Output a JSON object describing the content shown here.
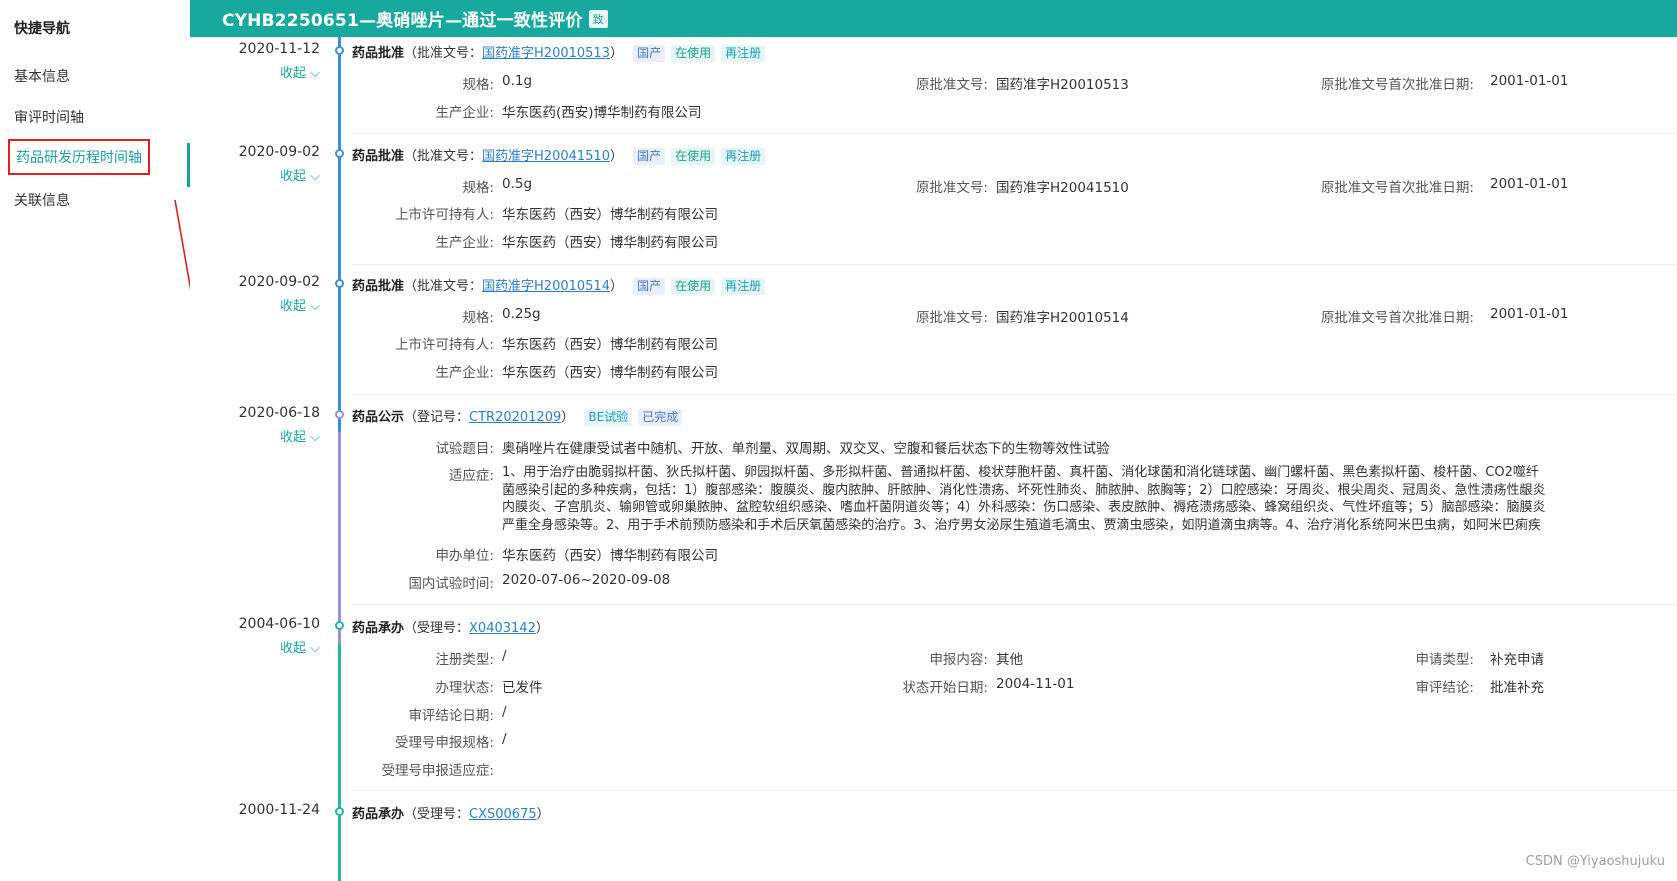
{
  "sidebar": {
    "title": "快捷导航",
    "items": [
      {
        "label": "基本信息"
      },
      {
        "label": "审评时间轴"
      },
      {
        "label": "药品研发历程时间轴"
      },
      {
        "label": "关联信息"
      }
    ]
  },
  "header": {
    "title": "CYHB2250651—奥硝唑片—通过一致性评价",
    "badge": "致"
  },
  "collapse_label": "收起",
  "entries": [
    {
      "date": "2020-11-12",
      "type": "药品批准",
      "ref_prefix": "（批准文号：",
      "ref": "国药准字H20010513",
      "ref_suffix": "）",
      "tags": [
        "国产",
        "在使用",
        "再注册"
      ],
      "spec_label": "规格:",
      "spec": "0.1g",
      "orig_label": "原批准文号:",
      "orig": "国药准字H20010513",
      "first_label": "原批准文号首次批准日期:",
      "first": "2001-01-01",
      "mfr_label": "生产企业:",
      "mfr": "华东医药(西安)博华制药有限公司"
    },
    {
      "date": "2020-09-02",
      "type": "药品批准",
      "ref_prefix": "（批准文号：",
      "ref": "国药准字H20041510",
      "ref_suffix": "）",
      "tags": [
        "国产",
        "在使用",
        "再注册"
      ],
      "spec_label": "规格:",
      "spec": "0.5g",
      "orig_label": "原批准文号:",
      "orig": "国药准字H20041510",
      "first_label": "原批准文号首次批准日期:",
      "first": "2001-01-01",
      "holder_label": "上市许可持有人:",
      "holder": "华东医药（西安）博华制药有限公司",
      "mfr_label": "生产企业:",
      "mfr": "华东医药（西安）博华制药有限公司"
    },
    {
      "date": "2020-09-02",
      "type": "药品批准",
      "ref_prefix": "（批准文号：",
      "ref": "国药准字H20010514",
      "ref_suffix": "）",
      "tags": [
        "国产",
        "在使用",
        "再注册"
      ],
      "spec_label": "规格:",
      "spec": "0.25g",
      "orig_label": "原批准文号:",
      "orig": "国药准字H20010514",
      "first_label": "原批准文号首次批准日期:",
      "first": "2001-01-01",
      "holder_label": "上市许可持有人:",
      "holder": "华东医药（西安）博华制药有限公司",
      "mfr_label": "生产企业:",
      "mfr": "华东医药（西安）博华制药有限公司"
    },
    {
      "date": "2020-06-18",
      "type": "药品公示",
      "ref_prefix": "（登记号：",
      "ref": "CTR20201209",
      "ref_suffix": "）",
      "tags": [
        "BE试验",
        "已完成"
      ],
      "topic_label": "试验题目:",
      "topic": "奥硝唑片在健康受试者中随机、开放、单剂量、双周期、双交叉、空腹和餐后状态下的生物等效性试验",
      "indication_label": "适应症:",
      "indication_lines": [
        "1、用于治疗由脆弱拟杆菌、狄氏拟杆菌、卵园拟杆菌、多形拟杆菌、普通拟杆菌、梭状芽胞杆菌、真杆菌、消化球菌和消化链球菌、幽门螺杆菌、黑色素拟杆菌、梭杆菌、CO2噬纤",
        "菌感染引起的多种疾病，包括：1）腹部感染：腹膜炎、腹内脓肿、肝脓肿、消化性溃疡、坏死性肺炎、肺脓肿、脓胸等；2）口腔感染：牙周炎、根尖周炎、冠周炎、急性溃疡性龈炎",
        "内膜炎、子宫肌炎、输卵管或卵巢脓肿、盆腔软组织感染、嗜血杆菌阴道炎等；4）外科感染：伤口感染、表皮脓肿、褥疮溃疡感染、蜂窝组织炎、气性坏疽等；5）脑部感染：脑膜炎",
        "严重全身感染等。2、用于手术前预防感染和手术后厌氧菌感染的治疗。3、治疗男女泌尿生殖道毛滴虫、贾滴虫感染，如阴道滴虫病等。4、治疗消化系统阿米巴虫病，如阿米巴痢疾"
      ],
      "applicant_label": "申办单位:",
      "applicant": "华东医药（西安）博华制药有限公司",
      "period_label": "国内试验时间:",
      "period": "2020-07-06~2020-09-08"
    },
    {
      "date": "2004-06-10",
      "type": "药品承办",
      "ref_prefix": "（受理号：",
      "ref": "X0403142",
      "ref_suffix": "）",
      "reg_type_label": "注册类型:",
      "reg_type": "/",
      "content_label": "申报内容:",
      "content": "其他",
      "apply_type_label": "申请类型:",
      "apply_type": "补充申请",
      "status_label": "办理状态:",
      "status": "已发件",
      "status_date_label": "状态开始日期:",
      "status_date": "2004-11-01",
      "conclusion_label": "审评结论:",
      "conclusion": "批准补充",
      "conclusion_date_label": "审评结论日期:",
      "conclusion_date": "/",
      "spec_label": "受理号申报规格:",
      "spec": "/",
      "indication_label": "受理号申报适应症:",
      "indication": ""
    },
    {
      "date": "2000-11-24",
      "type": "药品承办",
      "ref_prefix": "（受理号：",
      "ref": "CXS00675",
      "ref_suffix": "）"
    }
  ],
  "watermark": "CSDN @Yiyaoshujuku",
  "colors": {
    "accent": "#17a99d",
    "line_blue": "#3b8fd6",
    "line_purple": "#9d8fe0",
    "line_teal": "#26b6a4",
    "highlight_red": "#e02020"
  }
}
